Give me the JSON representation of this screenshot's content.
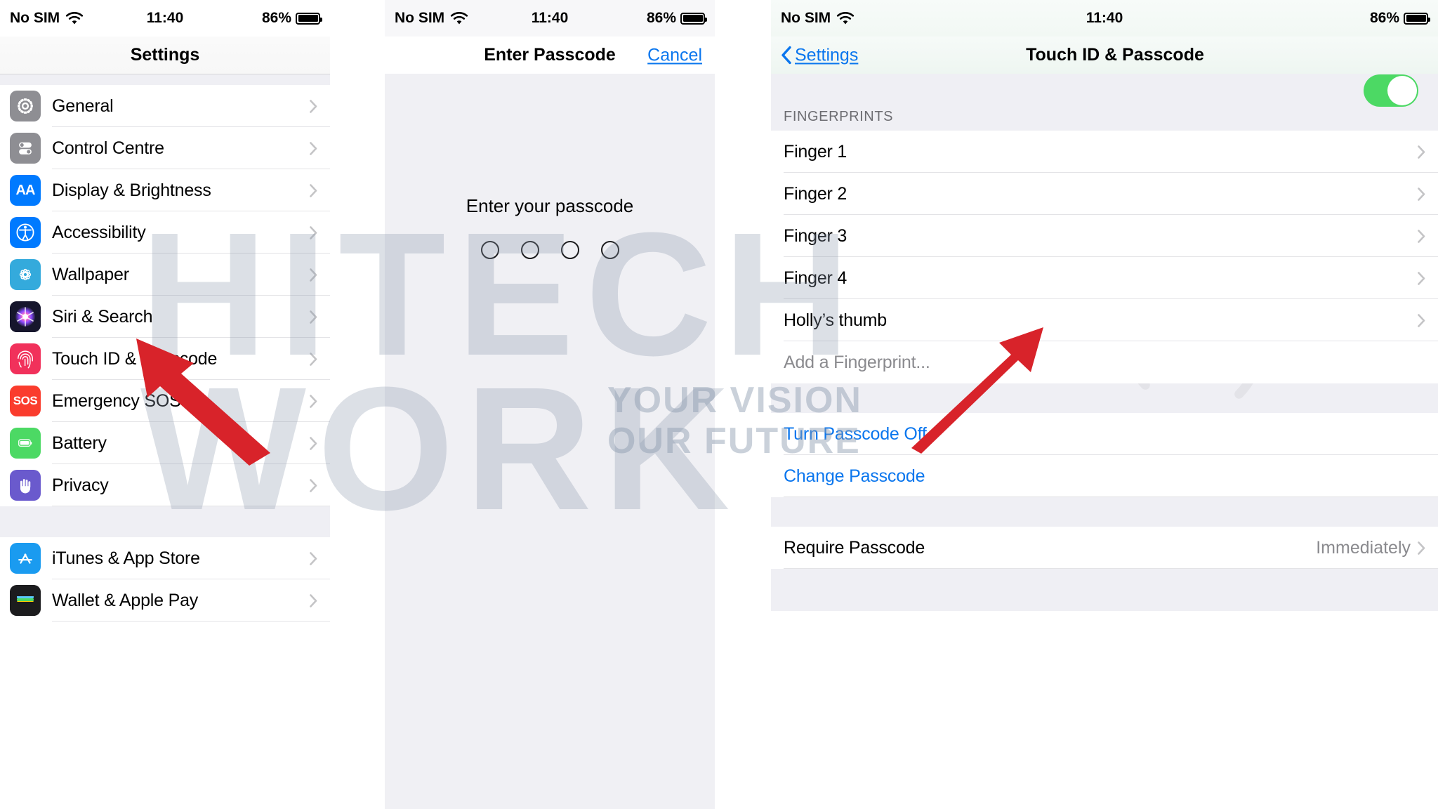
{
  "status_bar": {
    "carrier": "No SIM",
    "time": "11:40",
    "battery_percent": "86%",
    "wifi_icon": "wifi-icon",
    "battery_icon": "battery-icon"
  },
  "panel_settings": {
    "title": "Settings",
    "items": [
      {
        "label": "General",
        "icon": "gear-icon",
        "icon_color": "#8e8e93",
        "chevron": true
      },
      {
        "label": "Control Centre",
        "icon": "sliders-icon",
        "icon_color": "#8e8e93",
        "chevron": true
      },
      {
        "label": "Display & Brightness",
        "icon": "text-size-icon",
        "icon_color": "#007aff",
        "chevron": true
      },
      {
        "label": "Accessibility",
        "icon": "accessibility-icon",
        "icon_color": "#007aff",
        "chevron": true
      },
      {
        "label": "Wallpaper",
        "icon": "wallpaper-icon",
        "icon_color": "#34aadc",
        "chevron": true
      },
      {
        "label": "Siri & Search",
        "icon": "siri-icon",
        "icon_color": "#1c1c2e",
        "chevron": true
      },
      {
        "label": "Touch ID & Passcode",
        "icon": "fingerprint-icon",
        "icon_color": "#f1315b",
        "chevron": true
      },
      {
        "label": "Emergency SOS",
        "icon": "sos-icon",
        "icon_color": "#fa3c2d",
        "chevron": true
      },
      {
        "label": "Battery",
        "icon": "battery-app-icon",
        "icon_color": "#4cd964",
        "chevron": true
      },
      {
        "label": "Privacy",
        "icon": "privacy-hand-icon",
        "icon_color": "#6a5acd",
        "chevron": true
      }
    ],
    "items_group2": [
      {
        "label": "iTunes & App Store",
        "icon": "app-store-icon",
        "icon_color": "#1a9bf0",
        "chevron": true
      },
      {
        "label": "Wallet & Apple Pay",
        "icon": "wallet-icon",
        "icon_color": "#1c1c1e",
        "chevron": true
      }
    ]
  },
  "panel_passcode": {
    "title": "Enter Passcode",
    "cancel_label": "Cancel",
    "prompt": "Enter your passcode",
    "dot_count": 4,
    "dots_filled": 0
  },
  "panel_touchid": {
    "back_label": "Settings",
    "title": "Touch ID & Passcode",
    "section_header": "FINGERPRINTS",
    "fingerprints": [
      {
        "label": "Finger 1",
        "chevron": true
      },
      {
        "label": "Finger 2",
        "chevron": true
      },
      {
        "label": "Finger 3",
        "chevron": true
      },
      {
        "label": "Finger 4",
        "chevron": true
      },
      {
        "label": "Holly’s thumb",
        "chevron": true
      }
    ],
    "add_fingerprint_label": "Add a Fingerprint...",
    "passcode_actions": [
      {
        "label": "Turn Passcode Off"
      },
      {
        "label": "Change Passcode"
      }
    ],
    "require_passcode": {
      "label": "Require Passcode",
      "value": "Immediately",
      "chevron": true
    }
  },
  "watermark": {
    "line1": "HITECH",
    "line2": "WORK",
    "tagline1": "YOUR VISION",
    "tagline2": "OUR FUTURE"
  },
  "annotations": {
    "arrow_color": "#d8232a",
    "arrow_1_target": "Touch ID & Passcode",
    "arrow_2_target": "Change Passcode"
  },
  "colors": {
    "accent_blue": "#0a76ee",
    "list_bg": "#ffffff",
    "group_bg": "#efeff4",
    "separator": "#e3e3e6",
    "muted_text": "#8a8a8e"
  }
}
